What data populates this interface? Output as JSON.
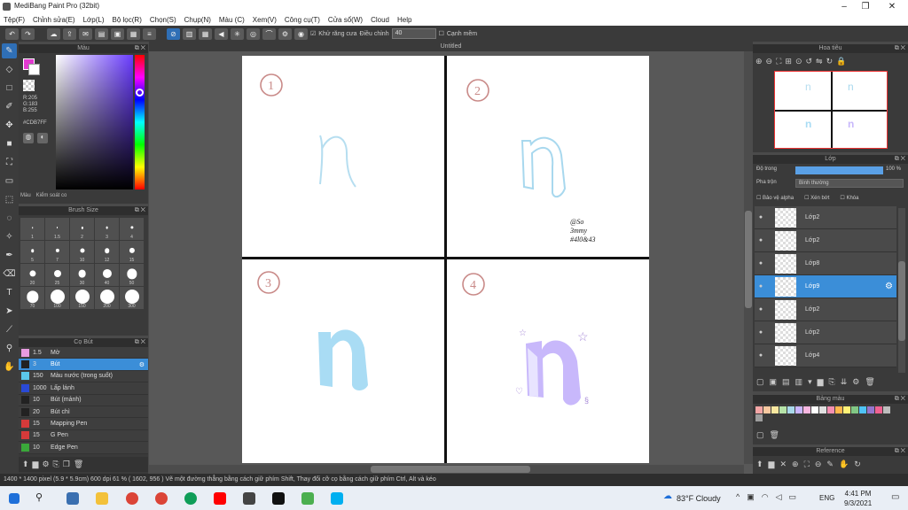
{
  "window": {
    "title": "MediBang Paint Pro (32bit)"
  },
  "menu": [
    "Tệp(F)",
    "Chỉnh sửa(E)",
    "Lớp(L)",
    "Bộ lọc(R)",
    "Chọn(S)",
    "Chụp(N)",
    "Màu (C)",
    "Xem(V)",
    "Công cụ(T)",
    "Cửa sổ(W)",
    "Cloud",
    "Help"
  ],
  "toolbar": {
    "antialias_label": "Khử răng cưa",
    "adjust_label": "Điều chỉnh",
    "adjust_value": "40",
    "soft_label": "Cạnh mềm"
  },
  "color_panel": {
    "title": "Màu",
    "r": "R:205",
    "g": "G:183",
    "b": "B:255",
    "hex": "#CDB7FF",
    "tab_color": "Màu",
    "tab_check": "Kiểm soát co"
  },
  "brush_size": {
    "title": "Brush Size",
    "sizes": [
      "1",
      "1.5",
      "2",
      "3",
      "4",
      "5",
      "7",
      "10",
      "12",
      "15",
      "20",
      "25",
      "30",
      "40",
      "50",
      "70",
      "100",
      "150",
      "200",
      "300"
    ]
  },
  "brush_panel": {
    "title": "Cọ Bút",
    "items": [
      {
        "num": "1.5",
        "name": "Mờ",
        "color": "#e79be0"
      },
      {
        "num": "3",
        "name": "Bút",
        "color": "#222222"
      },
      {
        "num": "150",
        "name": "Màu nước (trong suốt)",
        "color": "#5bc8ea"
      },
      {
        "num": "1000",
        "name": "Lấp lánh",
        "color": "#2a4ad6"
      },
      {
        "num": "10",
        "name": "Bút (mảnh)",
        "color": "#222222"
      },
      {
        "num": "20",
        "name": "Bút chì",
        "color": "#222222"
      },
      {
        "num": "15",
        "name": "Mapping Pen",
        "color": "#d63a3a"
      },
      {
        "num": "15",
        "name": "G Pen",
        "color": "#d63a3a"
      },
      {
        "num": "10",
        "name": "Edge Pen",
        "color": "#3aa83a"
      }
    ]
  },
  "canvas": {
    "title": "Untitled",
    "labels": [
      "1",
      "2",
      "3",
      "4"
    ],
    "signature": [
      "@So",
      "3mmy",
      "#4l0&43"
    ]
  },
  "navigator": {
    "title": "Hoa tiêu"
  },
  "layer_panel": {
    "title": "Lớp",
    "opacity_label": "Độ trong",
    "opacity_value": "100 %",
    "blend_label": "Pha trộn",
    "blend_value": "Bình thường",
    "protect_alpha": "Bảo vệ alpha",
    "clip": "Xén bớt",
    "lock": "Khóa",
    "layers": [
      {
        "name": "Lớp2"
      },
      {
        "name": "Lớp2"
      },
      {
        "name": "Lớp8"
      },
      {
        "name": "Lớp9"
      },
      {
        "name": "Lớp2"
      },
      {
        "name": "Lớp2"
      },
      {
        "name": "Lớp4"
      }
    ]
  },
  "palette": {
    "title": "Bảng màu",
    "colors": [
      "#f4a6a6",
      "#f7c8a0",
      "#f9e79f",
      "#b6e3a8",
      "#a8d8ea",
      "#c9b6ff",
      "#f7b6e0",
      "#ffffff",
      "#e0e0e0",
      "#f48fb1",
      "#ffb74d",
      "#fff176",
      "#81c784",
      "#4fc3f7",
      "#9575cd",
      "#f06292",
      "#bdbdbd",
      "#9e9e9e"
    ]
  },
  "reference": {
    "title": "Reference"
  },
  "status": {
    "text": "1400 * 1400 pixel   (5.9 * 5.9cm)   600 dpi   61 %   ( 1602, 956 )   Vẽ một đường thẳng bằng cách giữ phím Shift, Thay đổi cỡ cọ bằng cách giữ phím Ctrl, Alt và kéo"
  },
  "taskbar": {
    "weather": "83°F  Cloudy",
    "lang": "ENG",
    "time": "4:41 PM",
    "date": "9/3/2021"
  }
}
